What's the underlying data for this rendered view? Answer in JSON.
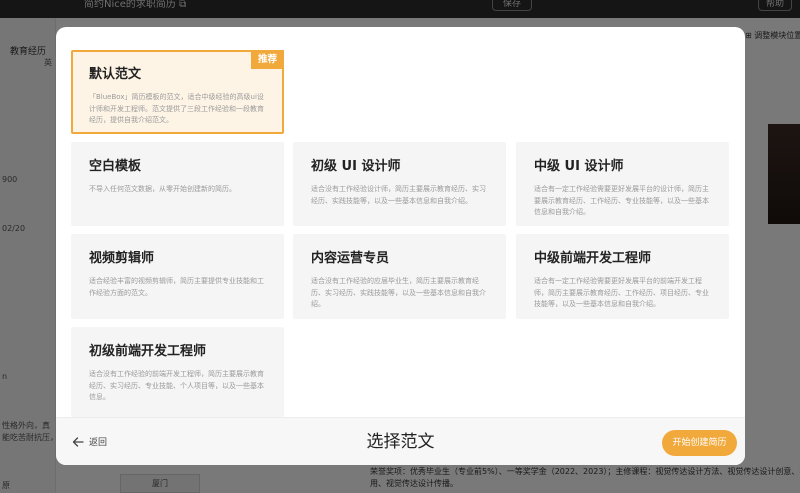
{
  "background": {
    "title": "简约Nice的求职简历 ⧉",
    "save_label": "保存",
    "help_label": "帮助",
    "left_tab": "教育经历",
    "left_short": "英",
    "left_values": [
      "900",
      "02/20",
      "n",
      "性格外向，真",
      "能吃苦耐抗压，",
      "原"
    ],
    "right_control": "⊞ 调整模块位置",
    "bottom_text": "荣誉奖项：优秀毕业生（专业前5%）、一等奖学金（2022、2023）；主修课程：视觉传达设计方法、视觉传达设计创意、视觉传",
    "bottom_text2": "用、视觉传达设计传播。",
    "bottom_button": "厦门"
  },
  "modal": {
    "templates": [
      {
        "title": "默认范文",
        "desc": "「BlueBox」简历模板的范文，适合中级经验的高级ui设计师和开发工程师。范文提供了三段工作经验和一段教育经历，提供自我介绍范文。",
        "badge": "推荐",
        "selected": true
      },
      {
        "title": "空白模板",
        "desc": "不导入任何范文数据，从零开始创建新的简历。"
      },
      {
        "title": "初级 UI 设计师",
        "desc": "适合没有工作经验设计师，简历主要展示教育经历、实习经历、实践技能等，以及一些基本信息和自我介绍。"
      },
      {
        "title": "中级 UI 设计师",
        "desc": "适合有一定工作经验需要更好发展平台的设计师，简历主要展示教育经历、工作经历、专业技能等，以及一些基本信息和自我介绍。"
      },
      {
        "title": "视频剪辑师",
        "desc": "适合经验丰富的视频剪辑师，简历主要提供专业技能和工作经验方面的范文。"
      },
      {
        "title": "内容运营专员",
        "desc": "适合没有工作经验的应届毕业生，简历主要展示教育经历、实习经历、实践技能等，以及一些基本信息和自我介绍。"
      },
      {
        "title": "中级前端开发工程师",
        "desc": "适合有一定工作经验需要更好发展平台的前端开发工程师，简历主要展示教育经历、工作经历、项目经历、专业技能等，以及一些基本信息和自我介绍。"
      },
      {
        "title": "初级前端开发工程师",
        "desc": "适合没有工作经验的前端开发工程师，简历主要展示教育经历、实习经历、专业技能、个人项目等，以及一些基本信息。"
      }
    ],
    "footer": {
      "back_label": "返回",
      "title": "选择范文",
      "start_label": "开始创建简历"
    },
    "colors": {
      "accent": "#f2a93b",
      "selected_bg": "#fdf4e6",
      "card_bg": "#f5f5f5"
    }
  }
}
